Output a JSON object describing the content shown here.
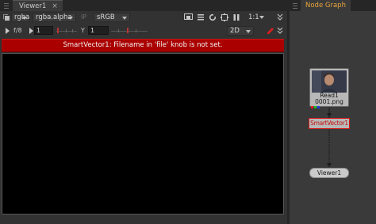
{
  "viewer": {
    "tab_label": "Viewer1",
    "tab_close": "×",
    "channels": {
      "layer": "rgba",
      "alpha_channel": "rgba.alpha",
      "ip_label": "IP",
      "colorspace": "sRGB"
    },
    "zoom": "1:1",
    "frame": {
      "range_label": "f/8",
      "value": "1",
      "y_label": "Y",
      "y_value": "1"
    },
    "view_mode": "2D",
    "error_message": "SmartVector1: Filename in 'file' knob is not set."
  },
  "node_graph": {
    "tab_label": "Node Graph",
    "nodes": {
      "read": {
        "name": "Read1",
        "file": "0001.png"
      },
      "smartvector": {
        "name": "SmartVector1"
      },
      "viewer": {
        "name": "Viewer1"
      }
    }
  },
  "colors": {
    "error": "#aa0000",
    "accent_tab": "#e8a43a",
    "node_error": "#d51616"
  },
  "icons": [
    "grip-icon",
    "close-icon",
    "layers-icon",
    "roi-icon",
    "frame-icon",
    "lut-icon",
    "clip-icon",
    "pause-icon",
    "chevron-icon",
    "red-pen-icon"
  ]
}
